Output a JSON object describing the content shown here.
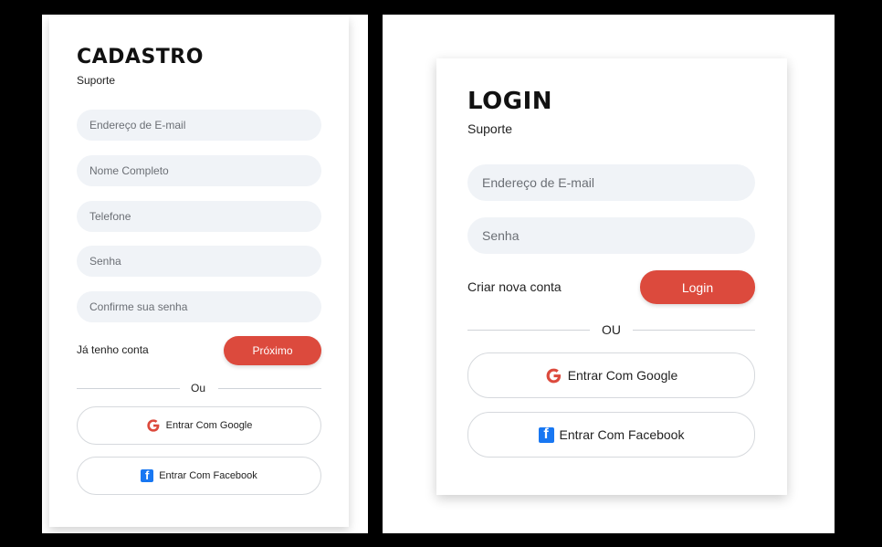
{
  "cadastro": {
    "title": "CADASTRO",
    "subtitle": "Suporte",
    "fields": [
      {
        "placeholder": "Endereço de E-mail"
      },
      {
        "placeholder": "Nome Completo"
      },
      {
        "placeholder": "Telefone"
      },
      {
        "placeholder": "Senha"
      },
      {
        "placeholder": "Confirme sua senha"
      }
    ],
    "link_text": "Já tenho conta",
    "next_button": "Próximo",
    "divider_text": "Ou",
    "google_button": "Entrar Com Google",
    "facebook_button": "Entrar Com Facebook"
  },
  "login": {
    "title": "LOGIN",
    "subtitle": "Suporte",
    "fields": [
      {
        "placeholder": "Endereço de E-mail"
      },
      {
        "placeholder": "Senha"
      }
    ],
    "link_text": "Criar nova conta",
    "login_button": "Login",
    "divider_text": "OU",
    "google_button": "Entrar Com Google",
    "facebook_button": "Entrar Com Facebook"
  },
  "colors": {
    "accent_red": "#dc4a3d",
    "field_bg": "#f0f3f7",
    "facebook_blue": "#1877f2"
  },
  "icons": {
    "google": "google-icon",
    "facebook": "facebook-icon"
  }
}
